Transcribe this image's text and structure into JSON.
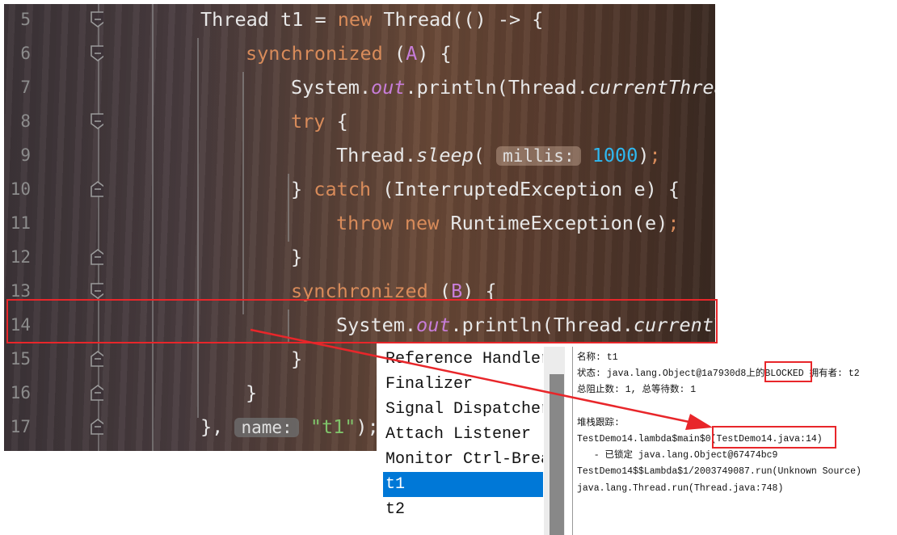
{
  "editor": {
    "lines": [
      {
        "n": "5",
        "indent": 0,
        "fold": "open",
        "tokens": [
          [
            "Thread t1 = ",
            ""
          ],
          [
            "new",
            "kw"
          ],
          [
            " Thread(() -> {",
            ""
          ]
        ]
      },
      {
        "n": "6",
        "indent": 1,
        "fold": "open",
        "tokens": [
          [
            "synchronized",
            "kw"
          ],
          [
            " (",
            ""
          ],
          [
            "A",
            "param"
          ],
          [
            ") {",
            ""
          ]
        ]
      },
      {
        "n": "7",
        "indent": 2,
        "fold": "",
        "tokens": [
          [
            "System.",
            ""
          ],
          [
            "out",
            "field"
          ],
          [
            ".println(Thread.",
            ""
          ],
          [
            "currentThread",
            "it"
          ]
        ]
      },
      {
        "n": "8",
        "indent": 2,
        "fold": "open",
        "tokens": [
          [
            "try",
            "kw"
          ],
          [
            " {",
            ""
          ]
        ]
      },
      {
        "n": "9",
        "indent": 3,
        "fold": "",
        "tokens": [
          [
            "Thread.",
            ""
          ],
          [
            "sleep",
            "it"
          ],
          [
            "( ",
            ""
          ],
          [
            "millis:",
            "hint"
          ],
          [
            " ",
            ""
          ],
          [
            "1000",
            "num"
          ],
          [
            ")",
            ""
          ],
          [
            ";",
            "kw"
          ]
        ]
      },
      {
        "n": "10",
        "indent": 2,
        "fold": "close",
        "tokens": [
          [
            "} ",
            ""
          ],
          [
            "catch",
            "kw"
          ],
          [
            " (InterruptedException e) {",
            ""
          ]
        ]
      },
      {
        "n": "11",
        "indent": 3,
        "fold": "",
        "tokens": [
          [
            "throw",
            "kw"
          ],
          [
            " ",
            ""
          ],
          [
            "new",
            "kw"
          ],
          [
            " RuntimeException(e)",
            ""
          ],
          [
            ";",
            "kw"
          ]
        ]
      },
      {
        "n": "12",
        "indent": 2,
        "fold": "close",
        "tokens": [
          [
            "}",
            ""
          ]
        ]
      },
      {
        "n": "13",
        "indent": 2,
        "fold": "open",
        "tokens": [
          [
            "synchronized",
            "kw"
          ],
          [
            " (",
            ""
          ],
          [
            "B",
            "param"
          ],
          [
            ") {",
            ""
          ]
        ]
      },
      {
        "n": "14",
        "indent": 3,
        "fold": "",
        "tokens": [
          [
            "System.",
            ""
          ],
          [
            "out",
            "field"
          ],
          [
            ".println(Thread.",
            ""
          ],
          [
            "currentT",
            "it"
          ]
        ]
      },
      {
        "n": "15",
        "indent": 2,
        "fold": "close",
        "tokens": [
          [
            "}",
            ""
          ]
        ]
      },
      {
        "n": "16",
        "indent": 1,
        "fold": "close",
        "tokens": [
          [
            "}",
            ""
          ]
        ]
      },
      {
        "n": "17",
        "indent": 0,
        "fold": "close",
        "tokens": [
          [
            "}, ",
            ""
          ],
          [
            "name:",
            "hint dark"
          ],
          [
            " ",
            ""
          ],
          [
            "\"t1\"",
            "str"
          ],
          [
            ");",
            ""
          ]
        ]
      }
    ]
  },
  "threads": {
    "items": [
      "Reference Handler",
      "Finalizer",
      "Signal Dispatcher",
      "Attach Listener",
      "Monitor Ctrl-Break",
      "t1",
      "t2"
    ],
    "selected": "t1",
    "selected_color": "#0078d7"
  },
  "details": {
    "name": "名称: t1",
    "state_prefix": "状态: java.lang.Object@1a7930d8上的",
    "state": "BLOCKED",
    "owner": " 拥有者: t2",
    "counts": "总阻止数: 1, 总等待数: 1",
    "stack_label": "堆栈跟踪:",
    "frame1_prefix": "TestDemo14.lambda$main$0",
    "frame1_loc": "(TestDemo14.java:14)",
    "locked": "   - 已锁定 java.lang.Object@67474bc9",
    "frame2": "TestDemo14$$Lambda$1/2003749087.run(Unknown Source)",
    "frame3": "java.lang.Thread.run(Thread.java:748)"
  },
  "annotation_color": "#e8262a"
}
